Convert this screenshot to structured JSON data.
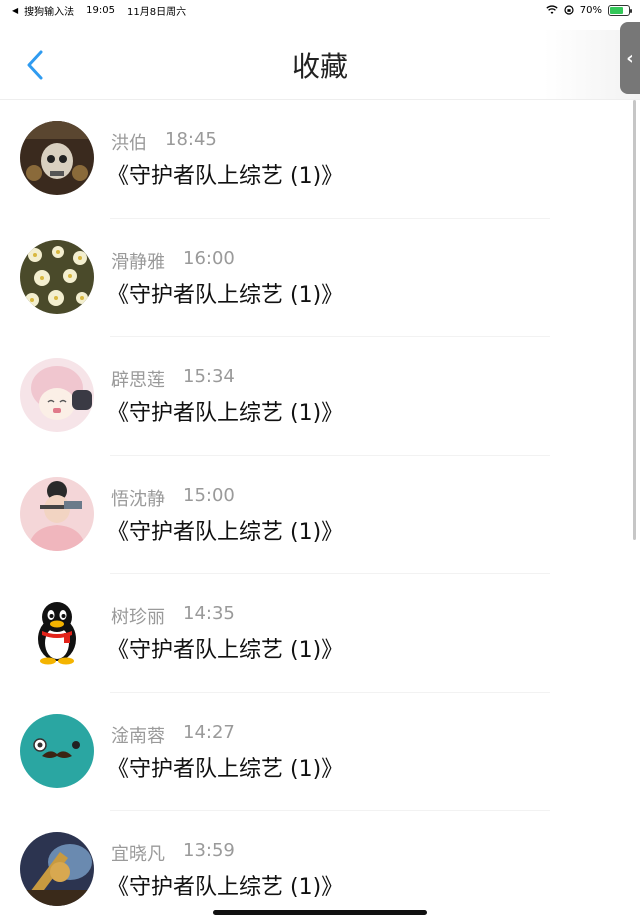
{
  "status_bar": {
    "app_back": "搜狗输入法",
    "time": "19:05",
    "date": "11月8日周六",
    "battery": "70%",
    "battery_level": 0.7
  },
  "nav": {
    "title": "收藏"
  },
  "items": [
    {
      "name": "洪伯",
      "time": "18:45",
      "message": "《守护者队上综艺 (1)》"
    },
    {
      "name": "滑静雅",
      "time": "16:00",
      "message": "《守护者队上综艺 (1)》"
    },
    {
      "name": "辟思莲",
      "time": "15:34",
      "message": "《守护者队上综艺 (1)》"
    },
    {
      "name": "悟沈静",
      "time": "15:00",
      "message": "《守护者队上综艺 (1)》"
    },
    {
      "name": "树珍丽",
      "time": "14:35",
      "message": "《守护者队上综艺 (1)》"
    },
    {
      "name": "淦南蓉",
      "time": "14:27",
      "message": "《守护者队上综艺 (1)》"
    },
    {
      "name": "宜晓凡",
      "time": "13:59",
      "message": "《守护者队上综艺 (1)》"
    }
  ],
  "colors": {
    "accent": "#2f9bf0"
  }
}
